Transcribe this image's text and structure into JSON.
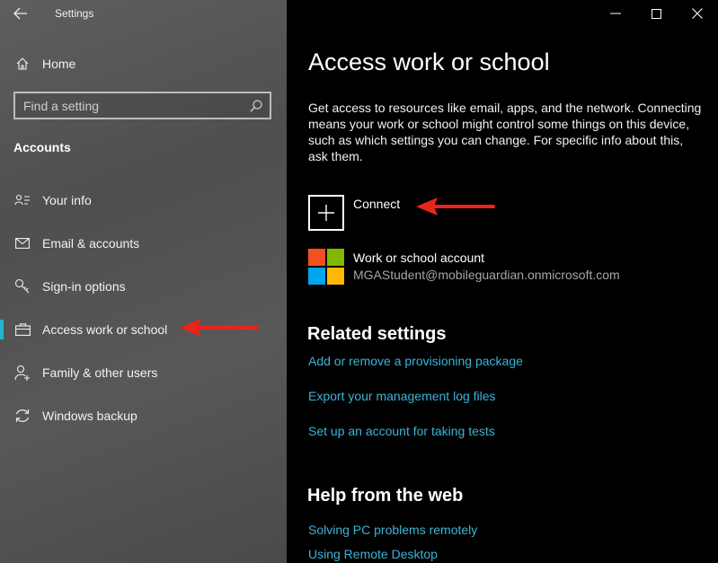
{
  "app": {
    "title": "Settings"
  },
  "sidebar": {
    "home_label": "Home",
    "search": {
      "placeholder": "Find a setting",
      "value": ""
    },
    "section_heading": "Accounts",
    "items": [
      {
        "label": "Your info",
        "icon": "person-card-icon"
      },
      {
        "label": "Email & accounts",
        "icon": "envelope-icon"
      },
      {
        "label": "Sign-in options",
        "icon": "key-icon"
      },
      {
        "label": "Access work or school",
        "icon": "briefcase-icon",
        "selected": true
      },
      {
        "label": "Family & other users",
        "icon": "person-add-icon"
      },
      {
        "label": "Windows backup",
        "icon": "sync-icon"
      }
    ]
  },
  "main": {
    "title": "Access work or school",
    "description": "Get access to resources like email, apps, and the network. Connecting means your work or school might control some things on this device, such as which settings you can change. For specific info about this, ask them.",
    "connect_label": "Connect",
    "account": {
      "name": "Work or school account",
      "email": "MGAStudent@mobileguardian.onmicrosoft.com"
    },
    "related_heading": "Related settings",
    "related_links": [
      "Add or remove a provisioning package",
      "Export your management log files",
      "Set up an account for taking tests"
    ],
    "help_heading": "Help from the web",
    "help_links": [
      "Solving PC problems remotely",
      "Using Remote Desktop"
    ]
  },
  "colors": {
    "accent": "#23b6c9",
    "link": "#3ab4d6",
    "annotation_arrow": "#e8251a",
    "ms_red": "#f25022",
    "ms_green": "#7fba00",
    "ms_blue": "#00a4ef",
    "ms_yellow": "#ffb900"
  }
}
